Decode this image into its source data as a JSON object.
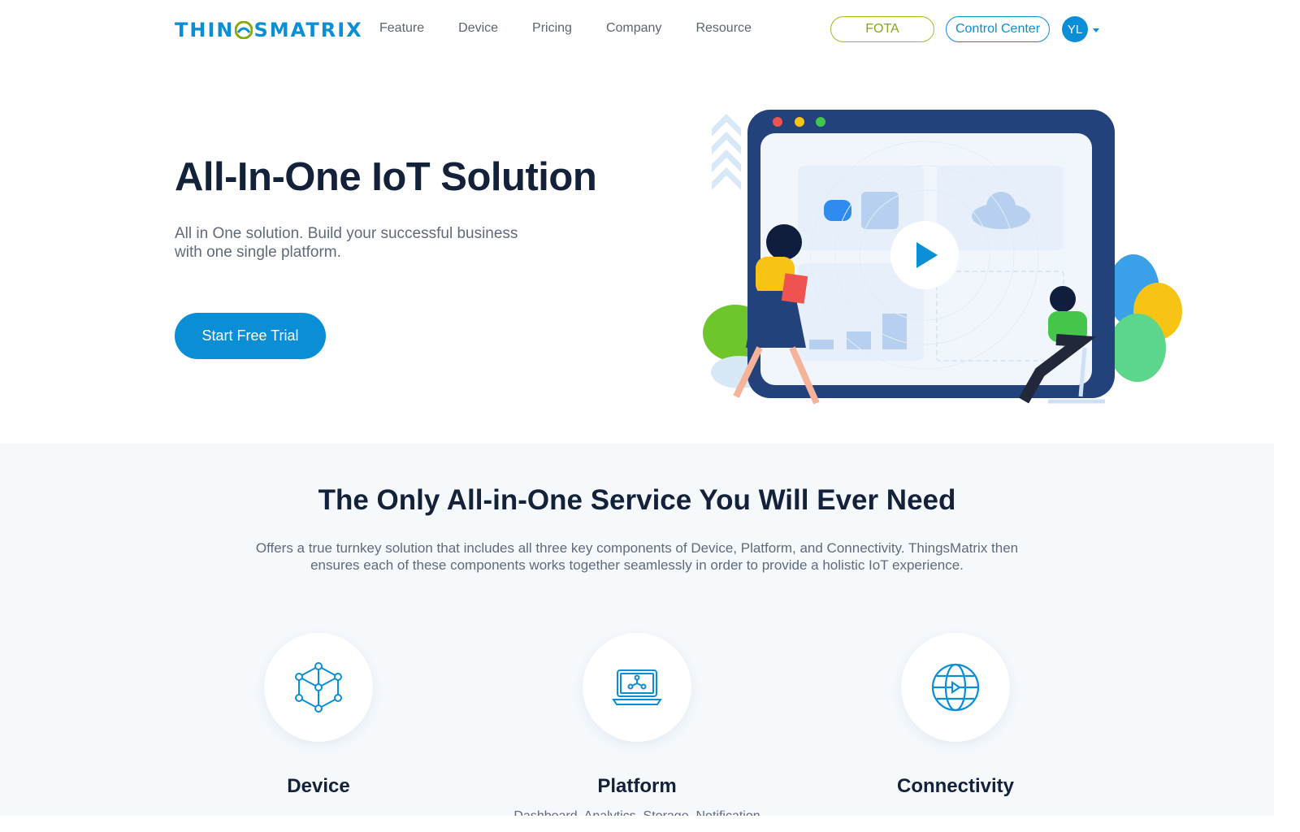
{
  "brand": {
    "name": "THINGSMATRIX",
    "color": "#0a8fd6",
    "accent": "#86aa0e"
  },
  "nav": {
    "items": [
      {
        "label": "Feature"
      },
      {
        "label": "Device"
      },
      {
        "label": "Pricing"
      },
      {
        "label": "Company"
      },
      {
        "label": "Resource"
      }
    ]
  },
  "header": {
    "fota_label": "FOTA",
    "control_center_label": "Control Center",
    "avatar_initials": "YL"
  },
  "hero": {
    "title": "All-In-One IoT Solution",
    "subtitle": "All in One solution. Build your successful business with one single platform.",
    "cta_label": "Start Free Trial"
  },
  "services": {
    "title": "The Only All-in-One Service You Will Ever Need",
    "description": "Offers a true turnkey solution that includes all three key components of Device, Platform, and Connectivity. ThingsMatrix then ensures each of these components works together seamlessly in order to provide a holistic IoT experience.",
    "cards": [
      {
        "title": "Device",
        "icon": "cube-network-icon",
        "text": ""
      },
      {
        "title": "Platform",
        "icon": "laptop-network-icon",
        "text": "Dashboard, Analytics, Storage, Notification"
      },
      {
        "title": "Connectivity",
        "icon": "globe-icon",
        "text": ""
      }
    ]
  }
}
